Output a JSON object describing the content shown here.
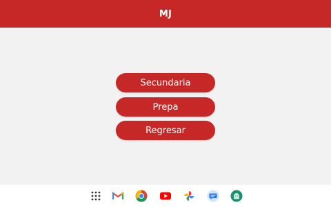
{
  "header": {
    "title": "MJ",
    "accent_color": "#c62828"
  },
  "menu": {
    "buttons": [
      {
        "label": "Secundaria"
      },
      {
        "label": "Prepa"
      },
      {
        "label": "Regresar"
      }
    ]
  },
  "taskbar": {
    "icons": [
      {
        "name": "app-launcher-icon"
      },
      {
        "name": "gmail-icon"
      },
      {
        "name": "chrome-icon"
      },
      {
        "name": "youtube-icon"
      },
      {
        "name": "photos-icon"
      },
      {
        "name": "messages-icon"
      },
      {
        "name": "android-icon"
      }
    ]
  }
}
